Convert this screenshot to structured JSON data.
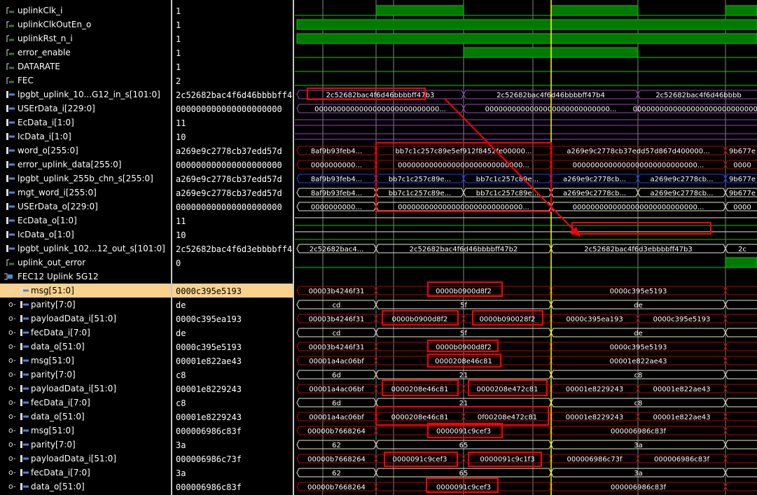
{
  "rows": [
    {
      "name": "uplinkClk_i",
      "value": "1",
      "icon": "scalar-signal-icon"
    },
    {
      "name": "uplinkClkOutEn_o",
      "value": "1",
      "icon": "scalar-signal-icon"
    },
    {
      "name": "uplinkRst_n_i",
      "value": "1",
      "icon": "scalar-signal-icon"
    },
    {
      "name": "error_enable",
      "value": "1",
      "icon": "scalar-signal-icon"
    },
    {
      "name": "DATARATE",
      "value": "1",
      "icon": "scalar-signal-icon"
    },
    {
      "name": "FEC",
      "value": "2",
      "icon": "scalar-signal-icon"
    },
    {
      "name": "lpgbt_uplink_10...G12_in_s[101:0]",
      "value": "2c52682bac4f6d46bbbbff4",
      "icon": "bus-signal-icon"
    },
    {
      "name": "USErData_i[229:0]",
      "value": "000000000000000000000",
      "icon": "bus-signal-icon"
    },
    {
      "name": "EcData_i[1:0]",
      "value": "11",
      "icon": "bus-signal-icon"
    },
    {
      "name": "IcData_i[1:0]",
      "value": "10",
      "icon": "bus-signal-icon"
    },
    {
      "name": "word_o[255:0]",
      "value": "a269e9c2778cb37edd57d",
      "icon": "bus-signal-icon"
    },
    {
      "name": "error_uplink_data[255:0]",
      "value": "000000000000000000000",
      "icon": "bus-signal-icon"
    },
    {
      "name": "lpgbt_uplink_255b_chn_s[255:0]",
      "value": "a269e9c2778cb37edd57d",
      "icon": "bus-signal-icon"
    },
    {
      "name": "mgt_word_i[255:0]",
      "value": "a269e9c2778cb37edd57d",
      "icon": "bus-signal-icon"
    },
    {
      "name": "USErData_o[229:0]",
      "value": "000000000000000000000",
      "icon": "bus-signal-icon"
    },
    {
      "name": "EcData_o[1:0]",
      "value": "11",
      "icon": "bus-signal-icon"
    },
    {
      "name": "IcData_o[1:0]",
      "value": "10",
      "icon": "bus-signal-icon"
    },
    {
      "name": "lpgbt_uplink_102...12_out_s[101:0]",
      "value": "2c52682bac4f6d3ebbbbff4",
      "icon": "bus-signal-icon"
    },
    {
      "name": "uplink_out_error",
      "value": "0",
      "icon": "scalar-signal-icon"
    },
    {
      "name": "FEC12 Uplink 5G12",
      "value": "",
      "icon": "group-icon"
    },
    {
      "name": "msg[51:0]",
      "value": "0000c395e5193",
      "icon": "bus-signal-icon"
    },
    {
      "name": "parity[7:0]",
      "value": "de",
      "icon": "bus-signal-icon"
    },
    {
      "name": "payloadData_i[51:0]",
      "value": "0000c395ea193",
      "icon": "bus-signal-icon"
    },
    {
      "name": "fecData_i[7:0]",
      "value": "de",
      "icon": "bus-signal-icon"
    },
    {
      "name": "data_o[51:0]",
      "value": "0000c395e5193",
      "icon": "bus-signal-icon"
    },
    {
      "name": "msg[51:0]",
      "value": "00001e822ae43",
      "icon": "bus-signal-icon"
    },
    {
      "name": "parity[7:0]",
      "value": "c8",
      "icon": "bus-signal-icon"
    },
    {
      "name": "payloadData_i[51:0]",
      "value": "00001e8229243",
      "icon": "bus-signal-icon"
    },
    {
      "name": "fecData_i[7:0]",
      "value": "c8",
      "icon": "bus-signal-icon"
    },
    {
      "name": "data_o[51:0]",
      "value": "00001e8229243",
      "icon": "bus-signal-icon"
    },
    {
      "name": "msg[51:0]",
      "value": "000006986c83f",
      "icon": "bus-signal-icon"
    },
    {
      "name": "parity[7:0]",
      "value": "3a",
      "icon": "bus-signal-icon"
    },
    {
      "name": "payloadData_i[51:0]",
      "value": "000006986c73f",
      "icon": "bus-signal-icon"
    },
    {
      "name": "fecData_i[7:0]",
      "value": "3a",
      "icon": "bus-signal-icon"
    },
    {
      "name": "data_o[51:0]",
      "value": "000006986c83f",
      "icon": "bus-signal-icon"
    }
  ],
  "waves": {
    "r6": [
      "2c52682bac4f6d46bbbbff47b3",
      "2c52682bac4f6d46bbbbff47b4",
      "2c52682bac4f6d46bbbb"
    ],
    "r7": [
      "0000000000000000000000000000...",
      "0000000000000000000000000000...",
      "0000000000000000000000000000..."
    ],
    "r10": [
      "8af9b93feb4...",
      "bb7c1c257c89e5ef912f8452fe00000...",
      "a269e9c2778cb37edd57d867d400000...",
      "9b677e"
    ],
    "r11": [
      "0000000000...",
      "0000000000000000000000000000...",
      "0000000000000000000000000000...",
      "0000"
    ],
    "r12": [
      "8af9b93feb4...",
      "bb7c1c257c89e...",
      "bb7c1c257c89e...",
      "a269e9c2778cb...",
      "a269e9c2778cb...",
      "9b677e"
    ],
    "r13": [
      "8af9b93feb4...",
      "bb7c1c257c89e...",
      "bb7c1c257c89e...",
      "a269e9c2778cb...",
      "a269e9c2778cb...",
      "9b677e"
    ],
    "r14": [
      "0000000000...",
      "0000000000000000000000000000...",
      "0000000000000000000000000000...",
      "0000"
    ],
    "r17": [
      "2c52682bac4...",
      "2c52682bac4f6d46bbbbff47b2",
      "2c52682bac4f6d3ebbbbff47b3",
      "2c"
    ],
    "r20": [
      "00003b4246f31",
      "0000b0900d8f2",
      "0000c395e5193"
    ],
    "r21": [
      "cd",
      "5f",
      "de"
    ],
    "r22": [
      "00003b4246f31",
      "0000b0900d8f2",
      "0000b090028f2",
      "0000c395ea193",
      "0000c395e5193"
    ],
    "r23": [
      "cd",
      "5f",
      "de"
    ],
    "r24": [
      "00003b4246f31",
      "0000b0900d8f2",
      "0000c395e5193"
    ],
    "r25": [
      "00001a4ac06bf",
      "0000208e46c81",
      "00001e822ae43"
    ],
    "r26": [
      "6d",
      "21",
      "c8"
    ],
    "r27": [
      "00001a4ac06bf",
      "0000208e46c81",
      "0000208e472c81",
      "00001e8229243",
      "00001e822ae43"
    ],
    "r28": [
      "6d",
      "21",
      "c8"
    ],
    "r29": [
      "00001a4ac06bf",
      "0000208e46c81",
      "0f00208e472c81",
      "00001e8229243",
      "00001e822ae43"
    ],
    "r30": [
      "00000b7668264",
      "0000091c9cef3",
      "000006986c83f"
    ],
    "r31": [
      "62",
      "65",
      "3a"
    ],
    "r32": [
      "00000b7668264",
      "0000091c9cef3",
      "0000091c9c1f3",
      "000006986c73f",
      "000006986c83f"
    ],
    "r33": [
      "62",
      "65",
      "3a"
    ],
    "r34": [
      "00000b7668264",
      "0000091c9cef3",
      "000006986c83f"
    ]
  },
  "colors": {
    "wave_green": "#00cc00",
    "wave_fill": "#007a00",
    "bus_purple": "#a040c0",
    "bus_red": "#c00000",
    "bus_blue": "#2040ff",
    "bus_yellow_white": "#e8e8c8",
    "cursor_yellow": "#ffff00",
    "annotation_red": "#ff0000",
    "selected_row": "#f9d28d"
  }
}
